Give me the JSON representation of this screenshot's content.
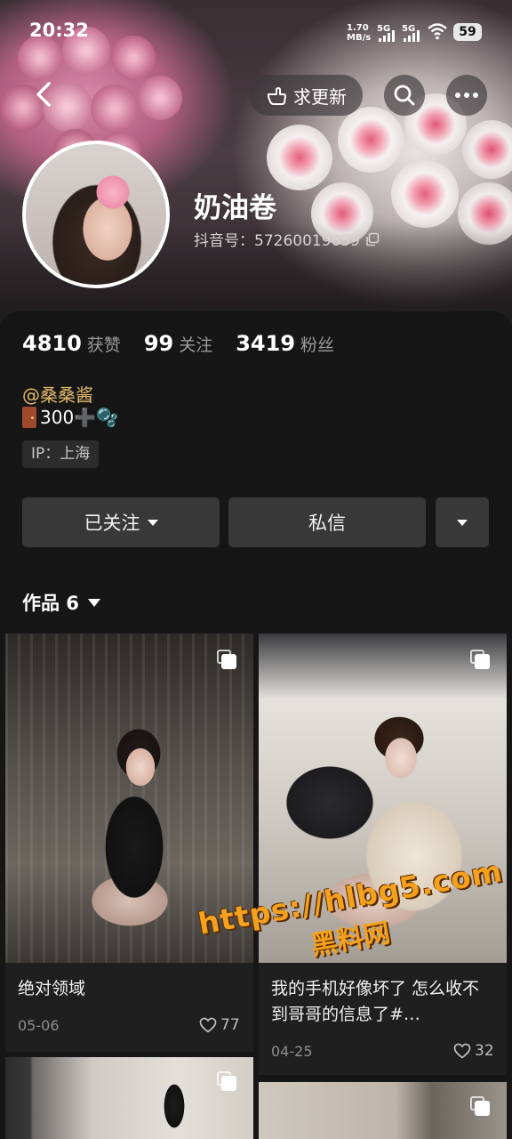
{
  "status_bar": {
    "time": "20:32",
    "net_speed_value": "1.70",
    "net_speed_unit": "MB/s",
    "sim1": "5G",
    "sim2": "5G",
    "battery": "59"
  },
  "header": {
    "update_label": "求更新",
    "back_icon": "chevron-left-icon",
    "search_icon": "search-icon",
    "more_icon": "more-dots-icon"
  },
  "profile": {
    "nickname": "奶油卷",
    "douyin_id": "抖音号：57260019659",
    "stats": [
      {
        "value": "4810",
        "label": "获赞"
      },
      {
        "value": "99",
        "label": "关注"
      },
      {
        "value": "3419",
        "label": "粉丝"
      }
    ],
    "mention": "@桑桑酱",
    "bio_line2": "300➕🫧",
    "ip": "IP：上海"
  },
  "actions": {
    "followed_label": "已关注",
    "message_label": "私信"
  },
  "works_tab": {
    "label": "作品 6"
  },
  "works": [
    {
      "title": "绝对领域",
      "date": "05-06",
      "likes": "77"
    },
    {
      "title": "我的手机好像坏了 怎么收不到哥哥的信息了#…",
      "date": "04-25",
      "likes": "32"
    }
  ],
  "watermark": {
    "url": "https://hlbg5.com",
    "name": "黑料网"
  }
}
